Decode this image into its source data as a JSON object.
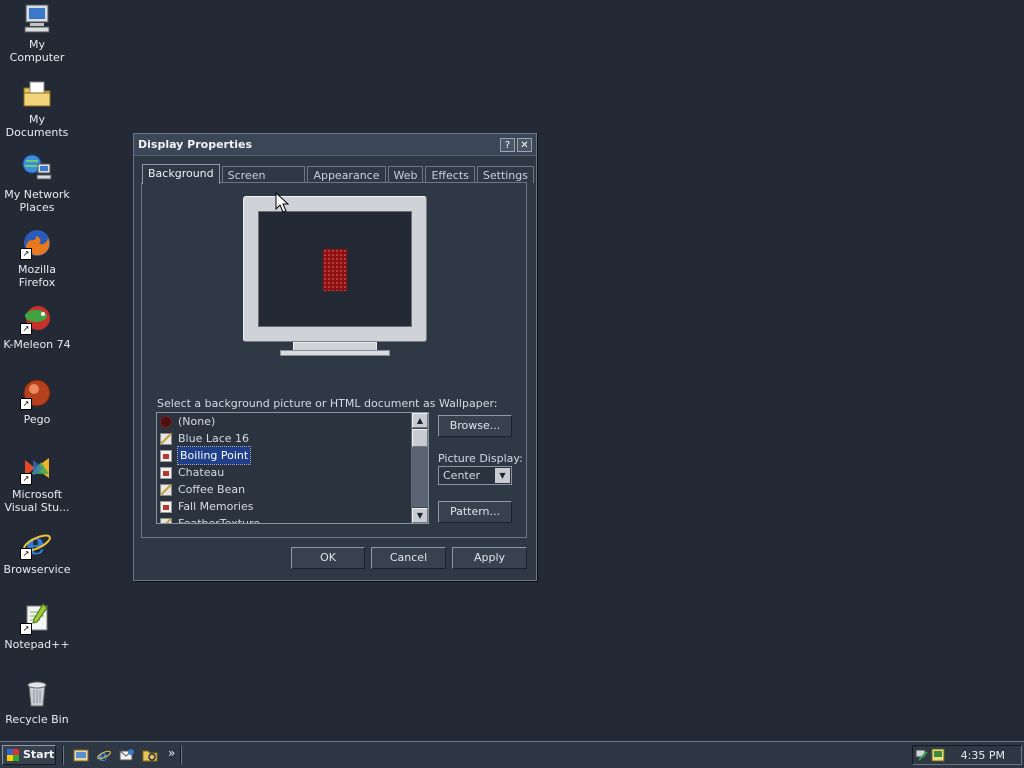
{
  "desktop": {
    "icons": [
      {
        "label": "My Computer",
        "icon": "computer-icon"
      },
      {
        "label": "My Documents",
        "icon": "documents-folder-icon"
      },
      {
        "label": "My Network Places",
        "icon": "network-places-icon"
      },
      {
        "label": "Mozilla Firefox",
        "icon": "firefox-icon"
      },
      {
        "label": "K-Meleon 74",
        "icon": "k-meleon-icon"
      },
      {
        "label": "Pego",
        "icon": "pego-icon"
      },
      {
        "label": "Microsoft Visual Stu...",
        "icon": "visual-studio-icon"
      },
      {
        "label": "Browservice",
        "icon": "internet-explorer-icon"
      },
      {
        "label": "Notepad++",
        "icon": "notepad-plus-plus-icon"
      },
      {
        "label": "Recycle Bin",
        "icon": "recycle-bin-icon"
      }
    ]
  },
  "dialog": {
    "title": "Display Properties",
    "help_button": "?",
    "close_button": "✕",
    "tabs": [
      {
        "label": "Background",
        "active": true
      },
      {
        "label": "Screen Saver",
        "active": false
      },
      {
        "label": "Appearance",
        "active": false
      },
      {
        "label": "Web",
        "active": false
      },
      {
        "label": "Effects",
        "active": false
      },
      {
        "label": "Settings",
        "active": false
      }
    ],
    "background": {
      "select_label": "Select a background picture or HTML document as Wallpaper:",
      "wallpapers": [
        {
          "label": "(None)",
          "icon": "none-icon",
          "selected": false
        },
        {
          "label": "Blue Lace 16",
          "icon": "paint-icon",
          "selected": false
        },
        {
          "label": "Boiling Point",
          "icon": "bitmap-icon",
          "selected": true
        },
        {
          "label": "Chateau",
          "icon": "bitmap-icon",
          "selected": false
        },
        {
          "label": "Coffee Bean",
          "icon": "paint-icon",
          "selected": false
        },
        {
          "label": "Fall Memories",
          "icon": "bitmap-icon",
          "selected": false
        },
        {
          "label": "FeatherTexture",
          "icon": "paint-icon",
          "selected": false
        }
      ],
      "browse_button": "Browse...",
      "picture_display_label": "Picture Display:",
      "picture_display_value": "Center",
      "pattern_button": "Pattern..."
    },
    "buttons": {
      "ok": "OK",
      "cancel": "Cancel",
      "apply": "Apply"
    }
  },
  "taskbar": {
    "start_label": "Start",
    "quicklaunch_overflow": "»",
    "clock": "4:35 PM"
  },
  "colors": {
    "desktop_bg": "#232a36",
    "selection": "#1f3f8a",
    "wallpaper_accent": "#8a1212"
  }
}
